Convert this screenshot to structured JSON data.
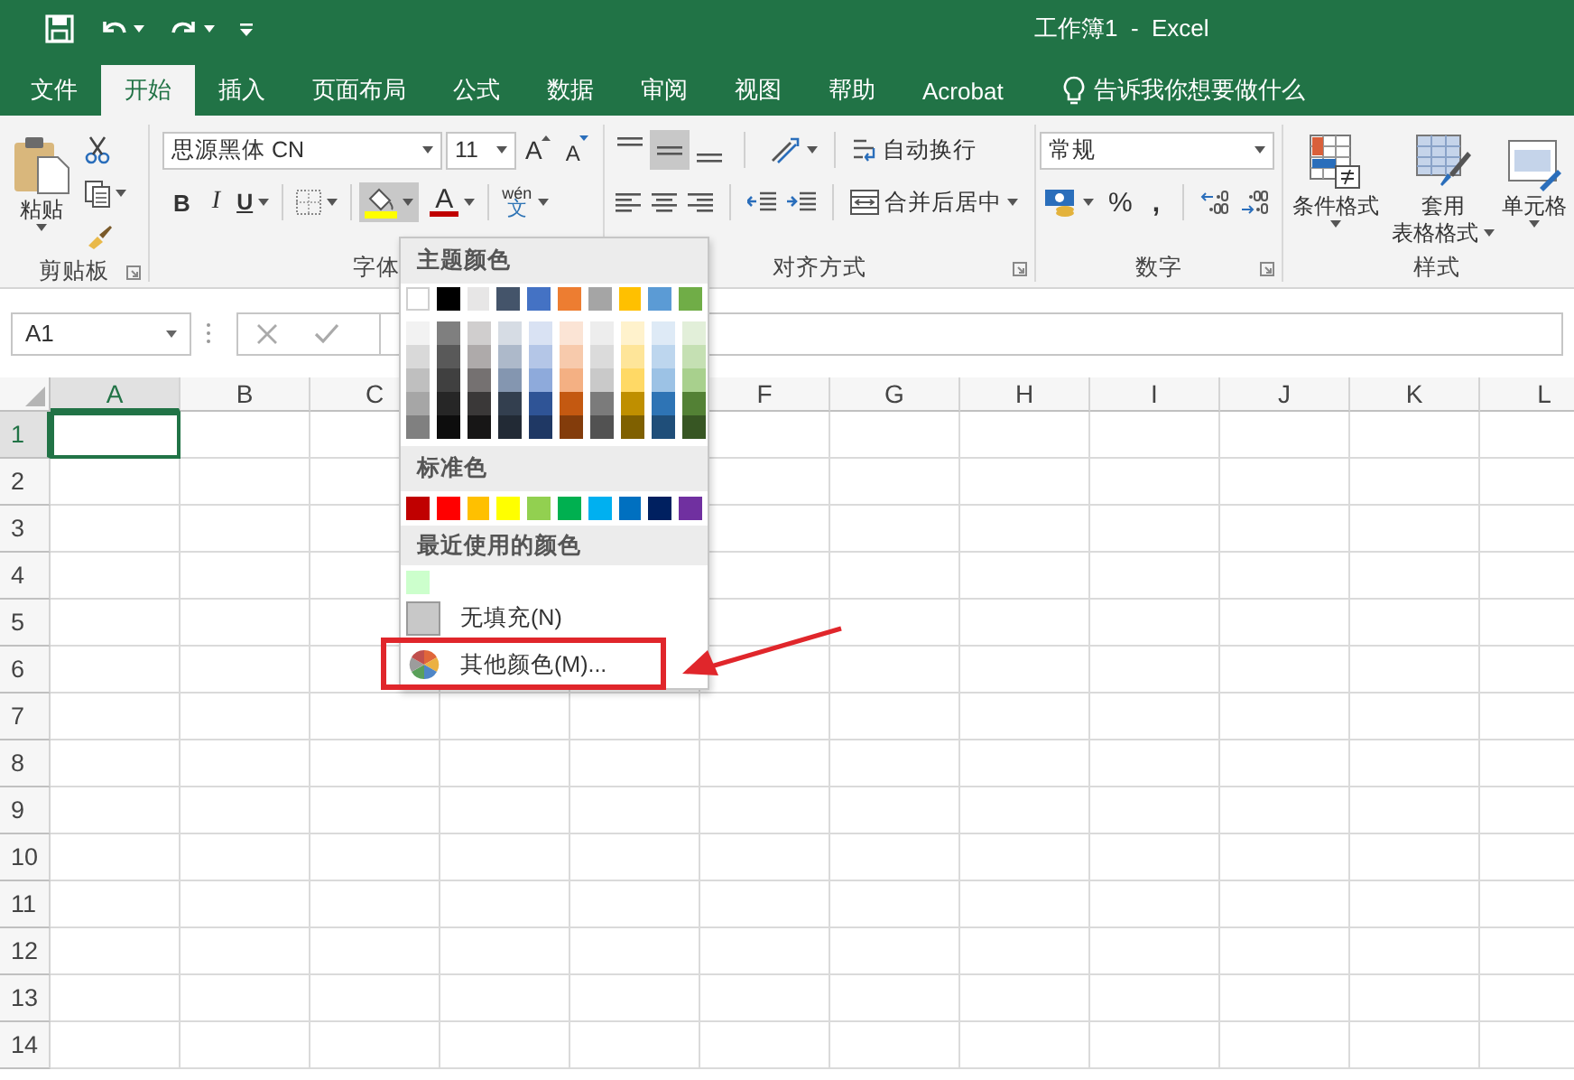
{
  "window": {
    "title": "工作簿1  -  Excel"
  },
  "tabs": [
    {
      "label": "文件",
      "selected": false
    },
    {
      "label": "开始",
      "selected": true
    },
    {
      "label": "插入",
      "selected": false
    },
    {
      "label": "页面布局",
      "selected": false
    },
    {
      "label": "公式",
      "selected": false
    },
    {
      "label": "数据",
      "selected": false
    },
    {
      "label": "审阅",
      "selected": false
    },
    {
      "label": "视图",
      "selected": false
    },
    {
      "label": "帮助",
      "selected": false
    },
    {
      "label": "Acrobat",
      "selected": false
    }
  ],
  "tell_me": {
    "placeholder": "告诉我你想要做什么"
  },
  "ribbon": {
    "clipboard": {
      "paste": "粘贴",
      "group": "剪贴板"
    },
    "font": {
      "font_name": "思源黑体 CN",
      "font_size": "11",
      "grow": "A",
      "shrink": "A",
      "bold": "B",
      "italic": "I",
      "underline": "U",
      "fill_pressed": true,
      "font_color": "A",
      "phonetic_top": "wén",
      "phonetic_char": "文",
      "group": "字体"
    },
    "alignment": {
      "vertical": [
        {
          "selected": false
        },
        {
          "selected": true
        },
        {
          "selected": false
        }
      ],
      "wrap": "自动换行",
      "merge": "合并后居中",
      "group": "对齐方式"
    },
    "number": {
      "format": "常规",
      "percent": "%",
      "comma": ",",
      "group": "数字"
    },
    "styles": {
      "conditional": "条件格式",
      "table_top": "套用",
      "table_bottom": "表格格式",
      "cell": "单元格",
      "group": "样式"
    }
  },
  "formula_bar": {
    "name_box": "A1"
  },
  "sheet": {
    "columns": [
      {
        "label": "A",
        "selected": true
      },
      {
        "label": "B",
        "selected": false
      },
      {
        "label": "C",
        "selected": false
      },
      {},
      {},
      {
        "label": "F",
        "selected": false
      },
      {
        "label": "G",
        "selected": false
      },
      {
        "label": "H",
        "selected": false
      },
      {
        "label": "I",
        "selected": false
      },
      {
        "label": "J",
        "selected": false
      },
      {
        "label": "K",
        "selected": false
      },
      {
        "label": "L",
        "selected": false
      }
    ],
    "rows": [
      {
        "label": "1",
        "selected": true
      },
      {
        "label": "2",
        "selected": false
      },
      {
        "label": "3",
        "selected": false
      },
      {
        "label": "4",
        "selected": false
      },
      {
        "label": "5",
        "selected": false
      },
      {
        "label": "6",
        "selected": false
      },
      {
        "label": "7",
        "selected": false
      },
      {
        "label": "8",
        "selected": false
      },
      {
        "label": "9",
        "selected": false
      },
      {
        "label": "10",
        "selected": false
      },
      {
        "label": "11",
        "selected": false
      },
      {
        "label": "12",
        "selected": false
      },
      {
        "label": "13",
        "selected": false
      },
      {
        "label": "14",
        "selected": false
      }
    ]
  },
  "fill_menu": {
    "theme_header": "主题颜色",
    "theme_colors": [
      {
        "color": "#ffffff",
        "shades": [
          {
            "color": "#f2f2f2"
          },
          {
            "color": "#d9d9d9"
          },
          {
            "color": "#bfbfbf"
          },
          {
            "color": "#a6a6a6"
          },
          {
            "color": "#808080"
          }
        ]
      },
      {
        "color": "#000000",
        "shades": [
          {
            "color": "#7f7f7f"
          },
          {
            "color": "#595959"
          },
          {
            "color": "#404040"
          },
          {
            "color": "#262626"
          },
          {
            "color": "#0d0d0d"
          }
        ]
      },
      {
        "color": "#e7e6e6",
        "shades": [
          {
            "color": "#d0cece"
          },
          {
            "color": "#aeaaaa"
          },
          {
            "color": "#757171"
          },
          {
            "color": "#3a3838"
          },
          {
            "color": "#171616"
          }
        ]
      },
      {
        "color": "#44546a",
        "shades": [
          {
            "color": "#d6dce4"
          },
          {
            "color": "#adb9ca"
          },
          {
            "color": "#8496b0"
          },
          {
            "color": "#333f4f"
          },
          {
            "color": "#222a35"
          }
        ]
      },
      {
        "color": "#4472c4",
        "shades": [
          {
            "color": "#d9e2f3"
          },
          {
            "color": "#b4c6e7"
          },
          {
            "color": "#8eaadb"
          },
          {
            "color": "#2f5496"
          },
          {
            "color": "#1f3864"
          }
        ]
      },
      {
        "color": "#ed7d31",
        "shades": [
          {
            "color": "#fbe4d5"
          },
          {
            "color": "#f7caac"
          },
          {
            "color": "#f4b083"
          },
          {
            "color": "#c45911"
          },
          {
            "color": "#833c0b"
          }
        ]
      },
      {
        "color": "#a5a5a5",
        "shades": [
          {
            "color": "#ededed"
          },
          {
            "color": "#dbdbdb"
          },
          {
            "color": "#c9c9c9"
          },
          {
            "color": "#7b7b7b"
          },
          {
            "color": "#525252"
          }
        ]
      },
      {
        "color": "#ffc000",
        "shades": [
          {
            "color": "#fff2cc"
          },
          {
            "color": "#fee599"
          },
          {
            "color": "#ffd965"
          },
          {
            "color": "#bf8f00"
          },
          {
            "color": "#7f6000"
          }
        ]
      },
      {
        "color": "#5b9bd5",
        "shades": [
          {
            "color": "#deeaf6"
          },
          {
            "color": "#bdd6ee"
          },
          {
            "color": "#9cc2e5"
          },
          {
            "color": "#2e74b5"
          },
          {
            "color": "#1f4e79"
          }
        ]
      },
      {
        "color": "#70ad47",
        "shades": [
          {
            "color": "#e2efd9"
          },
          {
            "color": "#c5e0b3"
          },
          {
            "color": "#a8d08d"
          },
          {
            "color": "#538135"
          },
          {
            "color": "#375623"
          }
        ]
      }
    ],
    "standard_header": "标准色",
    "standard_colors": [
      {
        "color": "#c00000"
      },
      {
        "color": "#ff0000"
      },
      {
        "color": "#ffc000"
      },
      {
        "color": "#ffff00"
      },
      {
        "color": "#92d050"
      },
      {
        "color": "#00b050"
      },
      {
        "color": "#00b0f0"
      },
      {
        "color": "#0070c0"
      },
      {
        "color": "#002060"
      },
      {
        "color": "#7030a0"
      }
    ],
    "recent_header": "最近使用的颜色",
    "recent_colors": [
      {
        "color": "#ccffcc"
      }
    ],
    "no_fill": "无填充(N)",
    "more_colors": "其他颜色(M)..."
  }
}
